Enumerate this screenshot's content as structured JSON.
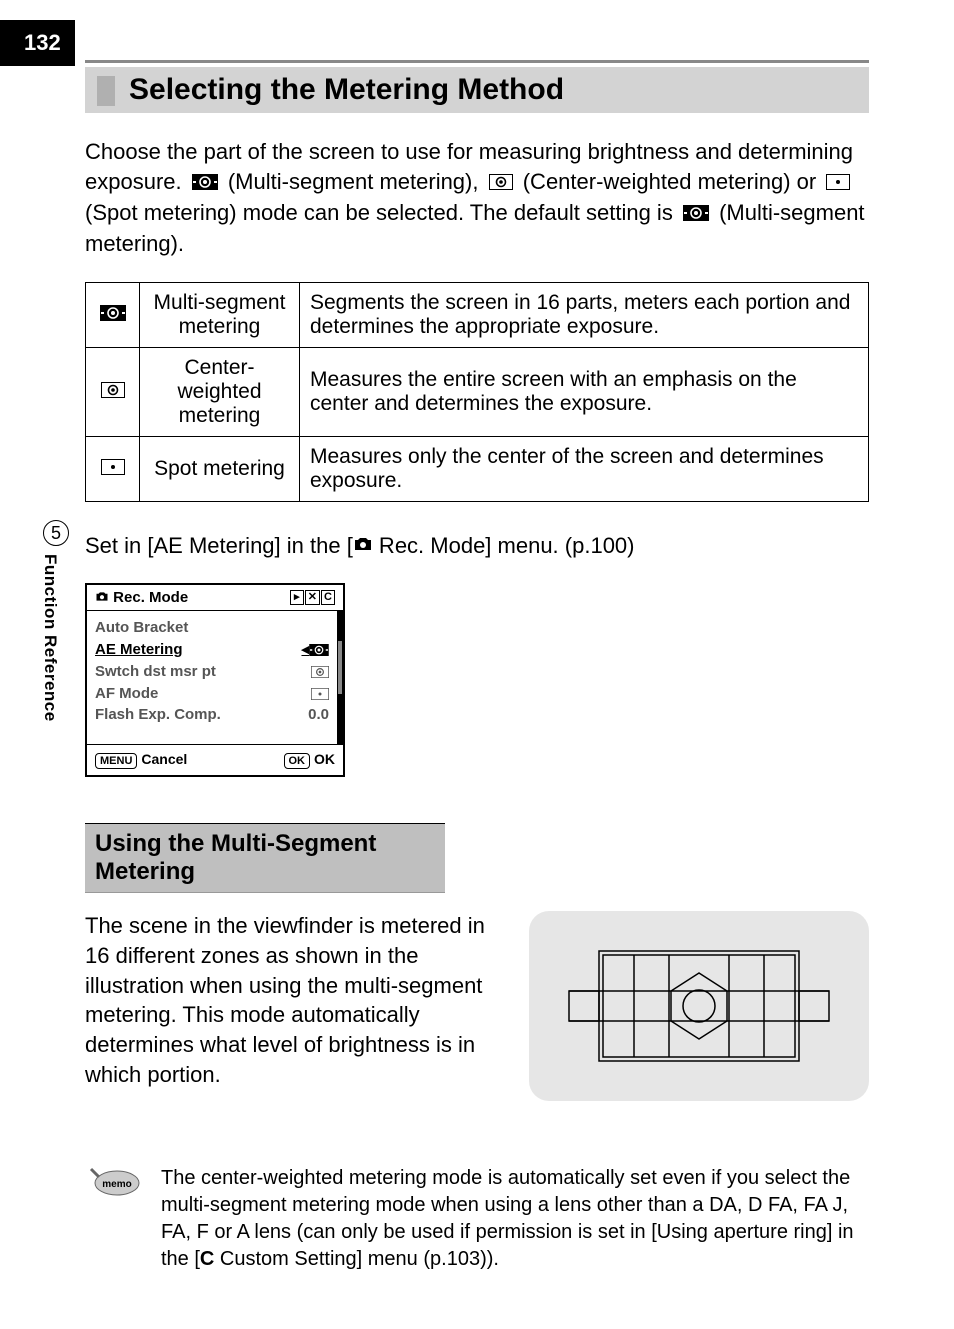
{
  "page_number": "132",
  "title": "Selecting the Metering Method",
  "intro": {
    "part1": "Choose the part of the screen to use for measuring brightness and determining exposure. ",
    "multi_label": " (Multi-segment metering), ",
    "center_label": " (Center-weighted metering) or ",
    "spot_label": " (Spot metering) mode can be selected. The default setting is ",
    "end": " (Multi-segment metering)."
  },
  "table": {
    "rows": [
      {
        "name": "Multi-segment metering",
        "desc": "Segments the screen in 16 parts, meters each portion and determines the appropriate exposure."
      },
      {
        "name": "Center-weighted metering",
        "desc": "Measures the entire screen with an emphasis on the center and determines the exposure."
      },
      {
        "name": "Spot metering",
        "desc": "Measures only the center of the screen and determines exposure."
      }
    ]
  },
  "set_in": {
    "before": "Set in [AE Metering] in the [",
    "menu": " Rec. Mode] menu. (p.100)"
  },
  "side": {
    "number": "5",
    "label": "Function Reference"
  },
  "lcd": {
    "title": "Rec. Mode",
    "items": {
      "auto_bracket": "Auto Bracket",
      "ae_metering": "AE Metering",
      "swtch": "Swtch dst msr pt",
      "af_mode": "AF Mode",
      "flash_exp": "Flash Exp. Comp.",
      "flash_val": "0.0"
    },
    "cancel": "Cancel",
    "ok": "OK"
  },
  "section": {
    "heading": "Using the Multi-Segment Metering",
    "text": "The scene in the viewfinder is metered in 16 different zones as shown in the illustration when using the multi-segment metering. This mode automatically determines what level of brightness is in which portion."
  },
  "memo": {
    "label": "memo",
    "text": "The center-weighted metering mode is automatically set even if you select the multi-segment metering mode when using a lens other than a DA, D FA, FA J, FA, F or A lens (can only be used if permission is set in [Using aperture ring] in the [",
    "custom": " Custom Setting] menu (p.103)).",
    "c": "C"
  }
}
